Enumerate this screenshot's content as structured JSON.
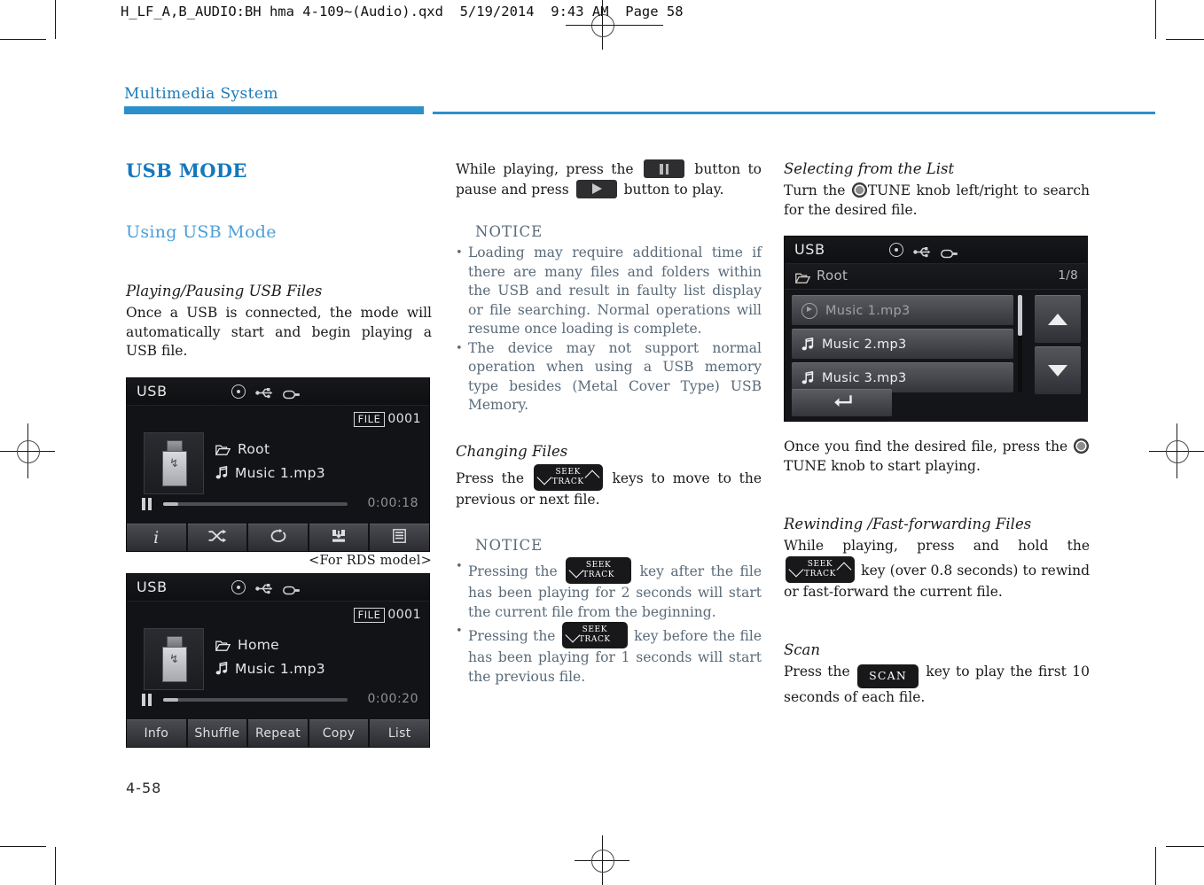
{
  "prepress": {
    "slug": "H_LF_A,B_AUDIO:BH hma 4-109~(Audio).qxd  5/19/2014  9:43 AM  Page 58"
  },
  "header": {
    "chapter_title": "Multimedia System",
    "accent_color": "#2b8fcb"
  },
  "folio": "4-58",
  "left_column": {
    "section_title": "USB MODE",
    "subsection_title": "Using USB Mode",
    "topic_1": "Playing/Pausing USB Files",
    "body_1": "Once a USB is connected, the mode will automatically start and begin playing a USB file.",
    "figure_1": {
      "source_label": "USB",
      "file_tag": "FILE",
      "file_number": "0001",
      "folder": "Root",
      "track": "Music 1.mp3",
      "time": "0:00:18",
      "tabs": [
        "i",
        "shuffle-icon",
        "repeat-icon",
        "copy-icon",
        "list-icon"
      ],
      "caption": "<For RDS model>"
    },
    "figure_2": {
      "source_label": "USB",
      "file_tag": "FILE",
      "file_number": "0001",
      "folder": "Home",
      "track": "Music 1.mp3",
      "time": "0:00:20",
      "tabs": [
        "Info",
        "Shuffle",
        "Repeat",
        "Copy",
        "List"
      ]
    }
  },
  "middle_column": {
    "intro_before_pause": "While playing, press the",
    "intro_mid": "button to pause and press",
    "intro_after_play": "button to play.",
    "notice_1": {
      "title": "NOTICE",
      "items": [
        "Loading may require additional time if there are many files and folders within the USB and result in faulty list display or file searching. Normal operations will resume once loading is complete.",
        "The device may not support normal operation when using a USB memory type besides (Metal Cover Type) USB Memory."
      ]
    },
    "topic_changing_files": "Changing Files",
    "changing_files_before": "Press the",
    "changing_files_after": "keys to move to the previous or next file.",
    "notice_2": {
      "title": "NOTICE",
      "items": [
        {
          "before": "Pressing the",
          "after": "key after the file has been playing for 2 seconds will start the current file from the beginning."
        },
        {
          "before": "Pressing the",
          "after": "key before the file has been playing for 1 seconds will start the previous file."
        }
      ]
    }
  },
  "right_column": {
    "topic_selecting": "Selecting from the List",
    "selecting_before_knob": "Turn the",
    "selecting_after_knob": "TUNE knob left/right to search for the desired file.",
    "figure_list": {
      "source_label": "USB",
      "path": "Root",
      "page_indicator": "1/8",
      "rows": [
        {
          "label": "Music 1.mp3",
          "icon": "play-circle-icon",
          "state": "playing"
        },
        {
          "label": "Music 2.mp3",
          "icon": "music-note-icon",
          "state": "normal"
        },
        {
          "label": "Music 3.mp3",
          "icon": "music-note-icon",
          "state": "normal"
        }
      ],
      "back_button": "back-arrow-icon",
      "scroll_up": "scroll-up-arrow",
      "scroll_down": "scroll-down-arrow"
    },
    "after_list_before_knob": "Once you find the",
    "after_list_mid": "desired file, press the",
    "after_list_after_knob": "TUNE knob to start playing.",
    "topic_rewinding": "Rewinding /Fast-forwarding Files",
    "rewinding_before": "While playing, press and hold the",
    "rewinding_after": "key (over 0.8 seconds) to rewind or fast-forward the current file.",
    "topic_scan": "Scan",
    "scan_before": "Press the",
    "scan_key": "SCAN",
    "scan_after": "key to play the first 10 seconds of each file."
  },
  "keys": {
    "seek_top": "SEEK",
    "seek_bottom": "TRACK"
  }
}
